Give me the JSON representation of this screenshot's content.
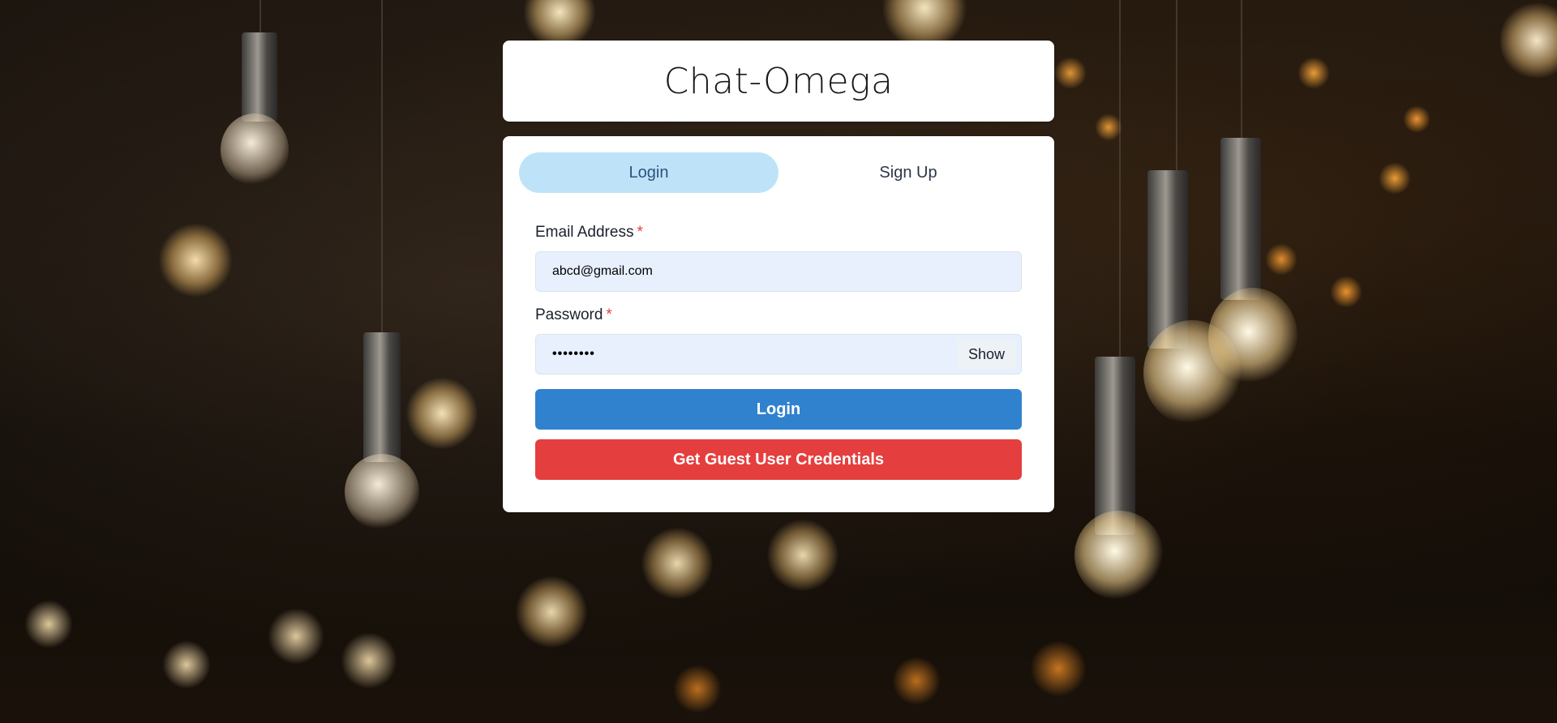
{
  "app": {
    "title": "Chat-Omega"
  },
  "tabs": [
    {
      "label": "Login",
      "active": true
    },
    {
      "label": "Sign Up",
      "active": false
    }
  ],
  "form": {
    "email": {
      "label": "Email Address",
      "required_mark": "*",
      "value": "abcd@gmail.com"
    },
    "password": {
      "label": "Password",
      "required_mark": "*",
      "value": "••••••••",
      "toggle_label": "Show"
    },
    "login_button": "Login",
    "guest_button": "Get Guest User Credentials"
  },
  "colors": {
    "tab_active_bg": "#bee3f8",
    "login_button": "#3182ce",
    "guest_button": "#e53e3e",
    "input_bg": "#e8f0fe",
    "required": "#e53e3e"
  },
  "background": {
    "icon": "hanging-light-bulbs-photo"
  }
}
